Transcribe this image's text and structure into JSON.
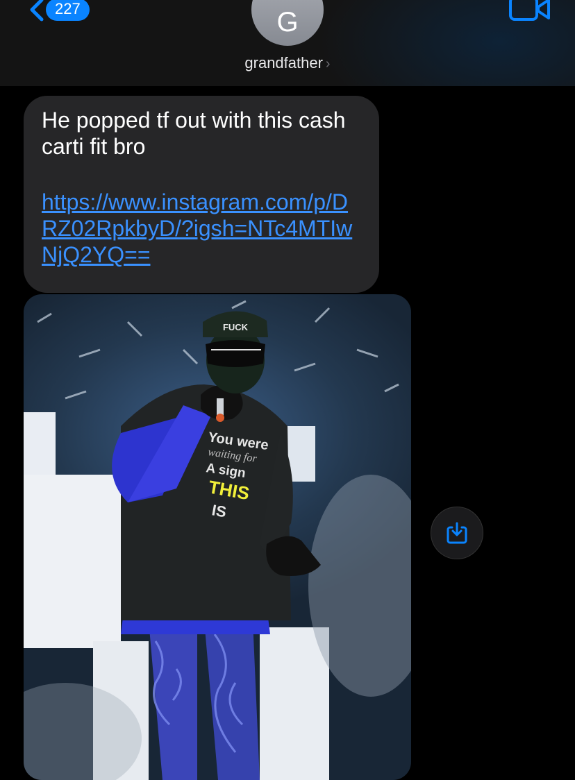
{
  "header": {
    "back_count": "227",
    "avatar_initial": "G",
    "contact_name": "grandfather",
    "contact_chevron": "›"
  },
  "message": {
    "text": "He popped tf out with this cash carti fit bro",
    "link": "https://www.instagram.com/p/DRZ02RpkbyD/?igsh=NTc4MTIwNjQ2YQ=="
  },
  "photo": {
    "cap_text": "FUCK",
    "shirt_lines": [
      "You were",
      "waiting for",
      "A sign",
      "THIS",
      "IS"
    ]
  },
  "icons": {
    "back": "chevron-left-icon",
    "video": "video-camera-icon",
    "save": "save-download-icon"
  },
  "colors": {
    "accent": "#0a84ff",
    "bubble": "#262628",
    "link": "#3a91ff"
  }
}
